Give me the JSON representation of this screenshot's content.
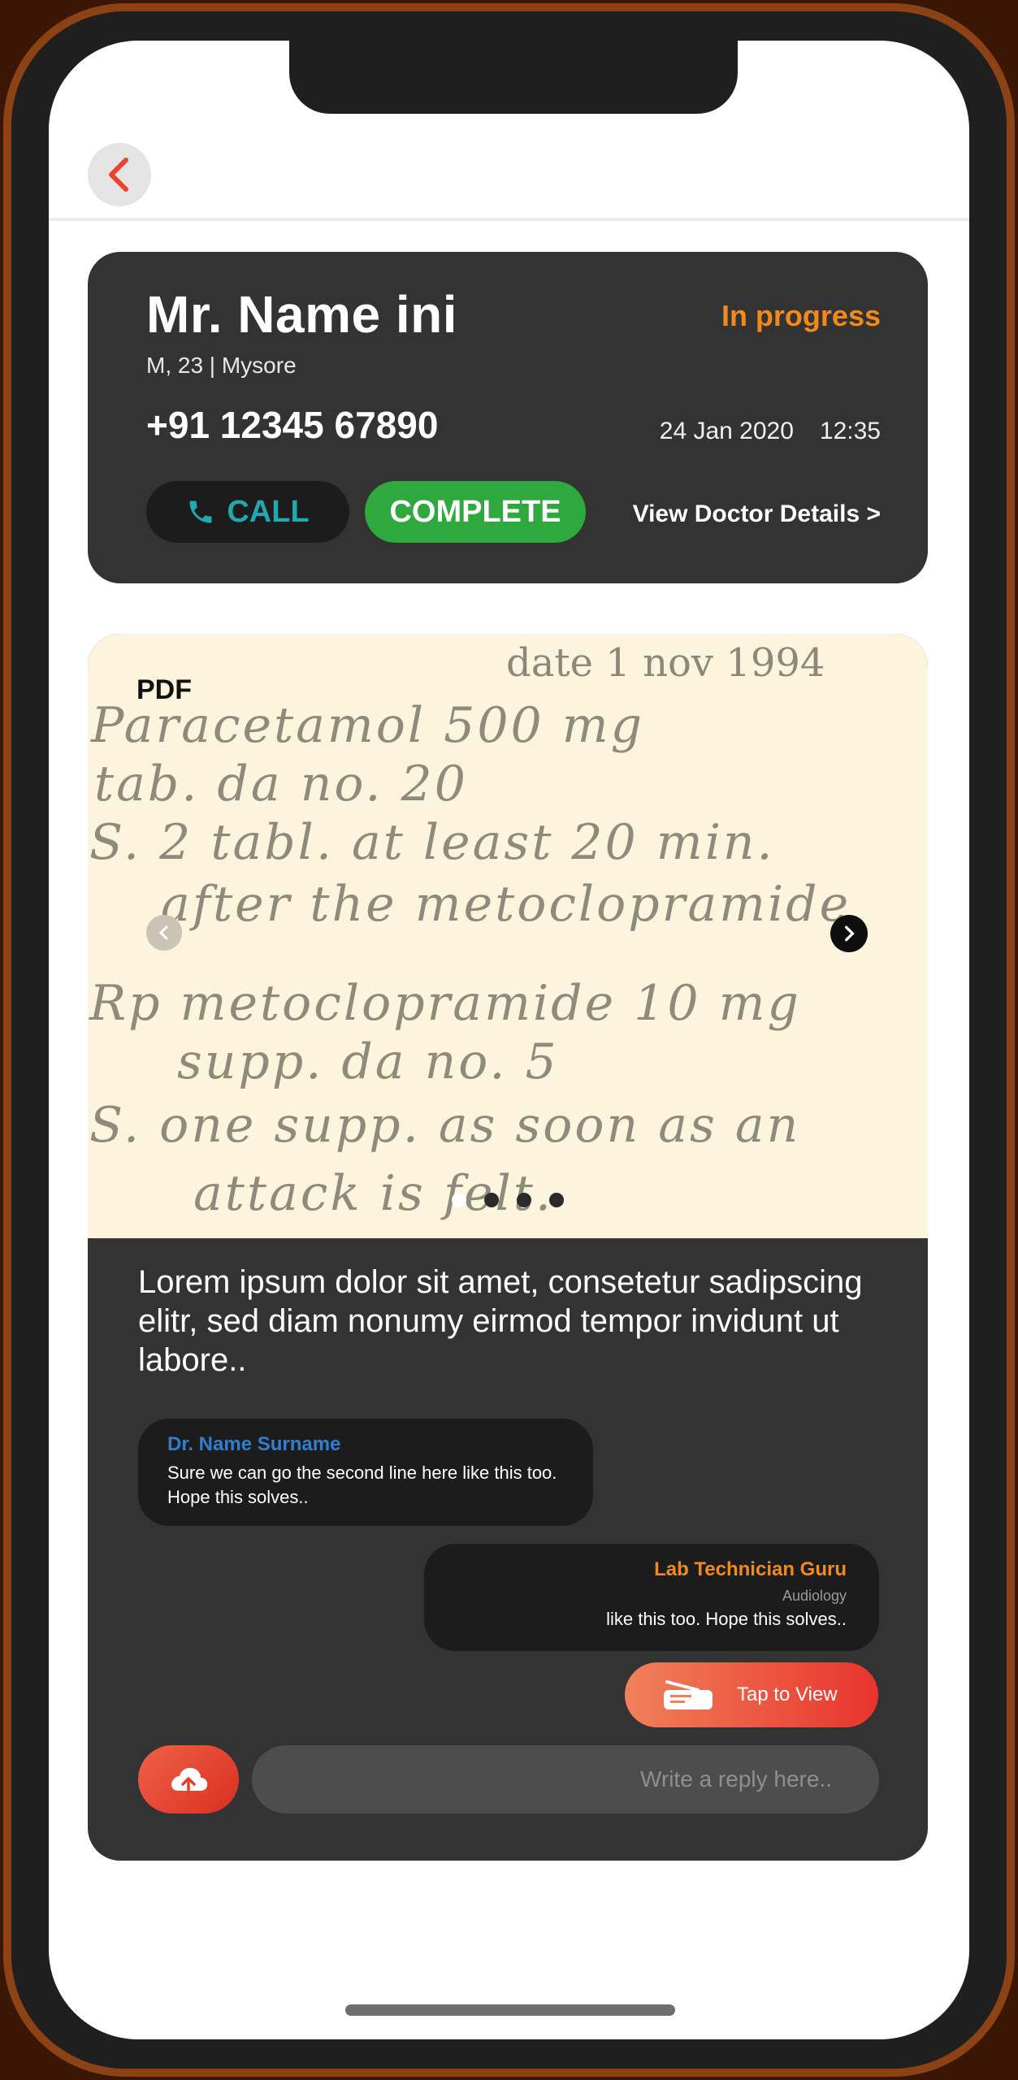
{
  "header": {
    "back_icon": "chevron-left-icon"
  },
  "patient": {
    "name": "Mr. Name ini",
    "meta": "M, 23 | Mysore",
    "phone": "+91 12345 67890",
    "status": "In progress",
    "date": "24 Jan 2020",
    "time": "12:35"
  },
  "actions": {
    "call_label": "CALL",
    "complete_label": "COMPLETE",
    "doctor_link": "View Doctor Details >"
  },
  "document": {
    "type_label": "PDF",
    "prescription_date": "date 1 nov 1994",
    "prescription_lines": [
      "Paracetamol  500 mg",
      "tab. da  no. 20",
      "S. 2 tabl. at  least 20 min.",
      "after the metoclopramide",
      "Rp  metoclopramide  10 mg",
      "supp.  da   no. 5",
      "S.  one supp. as soon as an",
      "attack  is felt."
    ],
    "page_count": 4,
    "current_page": 1,
    "description": "Lorem ipsum dolor sit amet, consetetur sadipscing elitr, sed diam nonumy eirmod tempor invidunt ut labore.."
  },
  "messages": {
    "left": {
      "sender": "Dr. Name Surname",
      "text": "Sure we can go the second line here like this too. Hope this solves.."
    },
    "right": {
      "sender": "Lab Technician Guru",
      "role": "Audiology",
      "text": "like this too. Hope this solves.."
    }
  },
  "attachment": {
    "label": "Tap to View",
    "icon": "scanner-icon"
  },
  "reply": {
    "placeholder": "Write a reply here..",
    "upload_icon": "cloud-upload-icon"
  },
  "colors": {
    "card_bg": "#333333",
    "status": "#f08a1c",
    "call": "#21a8b0",
    "complete": "#2fa83d",
    "doctor_name": "#2e7fd0",
    "accent": "#e8342d"
  }
}
